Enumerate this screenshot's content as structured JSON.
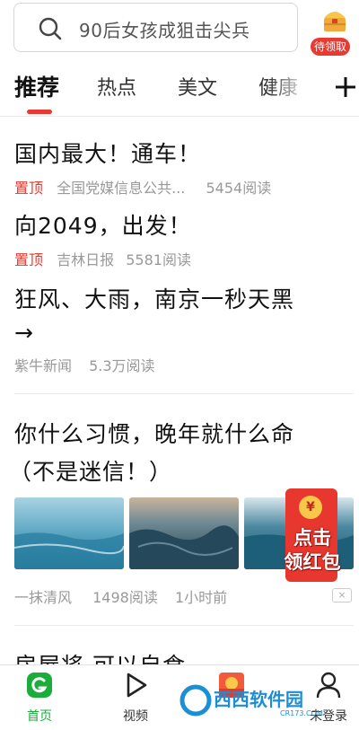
{
  "search": {
    "placeholder_text": "90后女孩成狙击尖兵"
  },
  "reward": {
    "label": "待领取"
  },
  "tabs": [
    "推荐",
    "热点",
    "美文",
    "健康"
  ],
  "feed": [
    {
      "title": "国内最大！通车！",
      "pin": "置顶",
      "source": "全国党媒信息公共...",
      "reads": "5454阅读"
    },
    {
      "title": "向2049，出发！",
      "pin": "置顶",
      "source": "吉林日报",
      "reads": "5581阅读"
    },
    {
      "title_line1": "狂风、大雨，南京一秒天黑",
      "title_line2": "→",
      "source": "紫牛新闻",
      "reads": "5.3万阅读"
    },
    {
      "title_line1": "你什么习惯，晚年就什么命",
      "title_line2": "（不是迷信！）",
      "source": "一抹清风",
      "reads": "1498阅读",
      "time": "1小时前",
      "close": "×"
    },
    {
      "title_partial": "房屋将 可以自食"
    }
  ],
  "redpacket": {
    "coin": "¥",
    "line1": "点击",
    "line2": "领红包"
  },
  "bottom_nav": [
    {
      "label": "首页",
      "icon": "home-icon"
    },
    {
      "label": "视频",
      "icon": "play-icon"
    },
    {
      "label": "",
      "icon": "sun-task-icon"
    },
    {
      "label": "未登录",
      "icon": "user-icon"
    }
  ],
  "watermark": {
    "text": "西西软件园",
    "sub": "CR173.COM"
  },
  "colors": {
    "accent": "#e83a31",
    "nav_active": "#1aad3a",
    "meta": "#999999"
  }
}
